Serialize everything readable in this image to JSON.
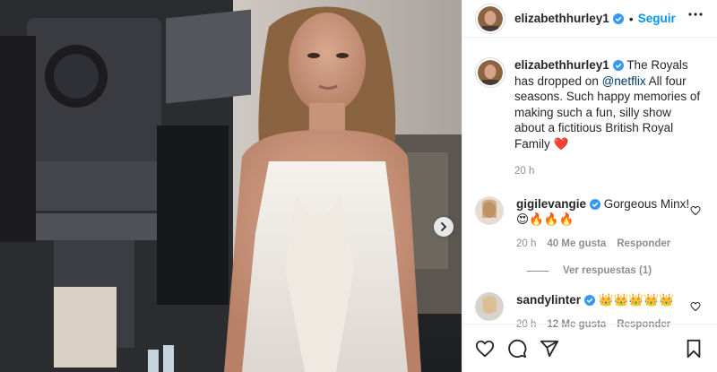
{
  "header": {
    "username": "elizabethhurley1",
    "follow_label": "Seguir"
  },
  "caption": {
    "username": "elizabethhurley1",
    "text_before": "The Royals has dropped on ",
    "mention": "@netflix",
    "text_after": " All four seasons. Such happy memories of making such a fun, silly show about a fictitious British Royal Family ",
    "emoji": "❤️",
    "time": "20 h"
  },
  "comments": [
    {
      "username": "gigilevangie",
      "text": "Gorgeous Minx! 😍🔥🔥🔥",
      "time": "20 h",
      "likes": "40 Me gusta",
      "reply_label": "Responder",
      "view_replies": "Ver respuestas (1)"
    },
    {
      "username": "sandylinter",
      "text": "👑👑👑👑👑",
      "time": "20 h",
      "likes": "12 Me gusta",
      "reply_label": "Responder"
    }
  ],
  "colors": {
    "accent": "#0095f6",
    "verified": "#3897f0",
    "like_heart": "#ed4956",
    "text": "#262626",
    "secondary": "#8e8e8e"
  },
  "icons": {
    "header": [
      "verified-badge-icon",
      "more-options-icon"
    ],
    "actions": [
      "heart-icon",
      "comment-icon",
      "share-icon",
      "bookmark-icon"
    ],
    "media": [
      "chevron-right-icon"
    ]
  }
}
